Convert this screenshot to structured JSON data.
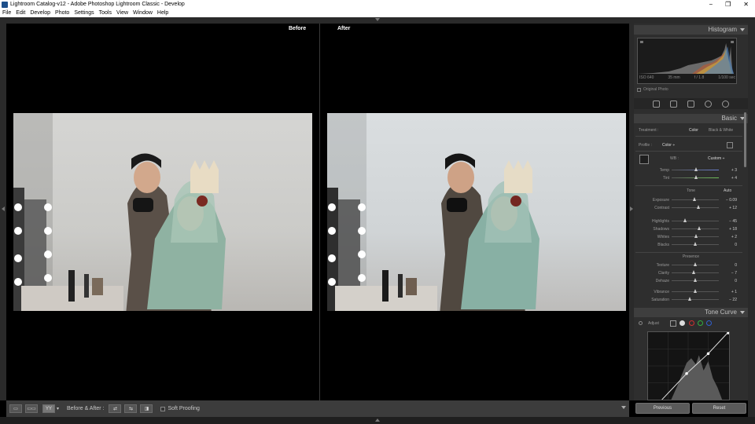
{
  "window": {
    "title": "Lightroom Catalog-v12 - Adobe Photoshop Lightroom Classic - Develop",
    "minimize": "−",
    "maximize": "❐",
    "close": "✕"
  },
  "menu": [
    "File",
    "Edit",
    "Develop",
    "Photo",
    "Settings",
    "Tools",
    "View",
    "Window",
    "Help"
  ],
  "viewer": {
    "before_label": "Before",
    "after_label": "After"
  },
  "toolbar": {
    "view_a": "▭",
    "view_b": "▭▭",
    "view_c": "YY",
    "dropdown": "▾",
    "before_after_label": "Before & After :",
    "swap_a": "⇄",
    "swap_b": "⇆",
    "swap_c": "◨",
    "soft_proofing": "Soft Proofing"
  },
  "histogram": {
    "title": "Histogram",
    "iso": "ISO 640",
    "focal": "35 mm",
    "aperture": "f / 1.8",
    "shutter": "1/100 sec",
    "original_photo": "Original Photo"
  },
  "basic": {
    "title": "Basic",
    "treatment_label": "Treatment :",
    "treatment_color": "Color",
    "treatment_bw": "Black & White",
    "profile_label": "Profile :",
    "profile_value": "Color ÷",
    "wb_label": "WB :",
    "wb_value": "Custom ÷",
    "tone_label": "Tone",
    "tone_auto": "Auto",
    "presence_label": "Presence",
    "sliders": [
      {
        "name": "Temp",
        "value": "+ 3",
        "pos": 0.52,
        "color": "#6a7fd0"
      },
      {
        "name": "Tint",
        "value": "+ 4",
        "pos": 0.52,
        "color": "#6fbf5a"
      },
      {
        "name": "Exposure",
        "value": "− 0.09",
        "pos": 0.49
      },
      {
        "name": "Contrast",
        "value": "+ 12",
        "pos": 0.56
      },
      {
        "name": "Highlights",
        "value": "− 45",
        "pos": 0.28
      },
      {
        "name": "Shadows",
        "value": "+ 18",
        "pos": 0.59
      },
      {
        "name": "Whites",
        "value": "+ 2",
        "pos": 0.51
      },
      {
        "name": "Blacks",
        "value": "0",
        "pos": 0.5
      },
      {
        "name": "Texture",
        "value": "0",
        "pos": 0.5
      },
      {
        "name": "Clarity",
        "value": "− 7",
        "pos": 0.46
      },
      {
        "name": "Dehaze",
        "value": "0",
        "pos": 0.5
      },
      {
        "name": "Vibrance",
        "value": "+ 1",
        "pos": 0.5
      },
      {
        "name": "Saturation",
        "value": "− 22",
        "pos": 0.39
      }
    ]
  },
  "tone_curve": {
    "title": "Tone Curve",
    "adjust_label": "Adjust"
  },
  "buttons": {
    "previous": "Previous",
    "reset": "Reset"
  }
}
